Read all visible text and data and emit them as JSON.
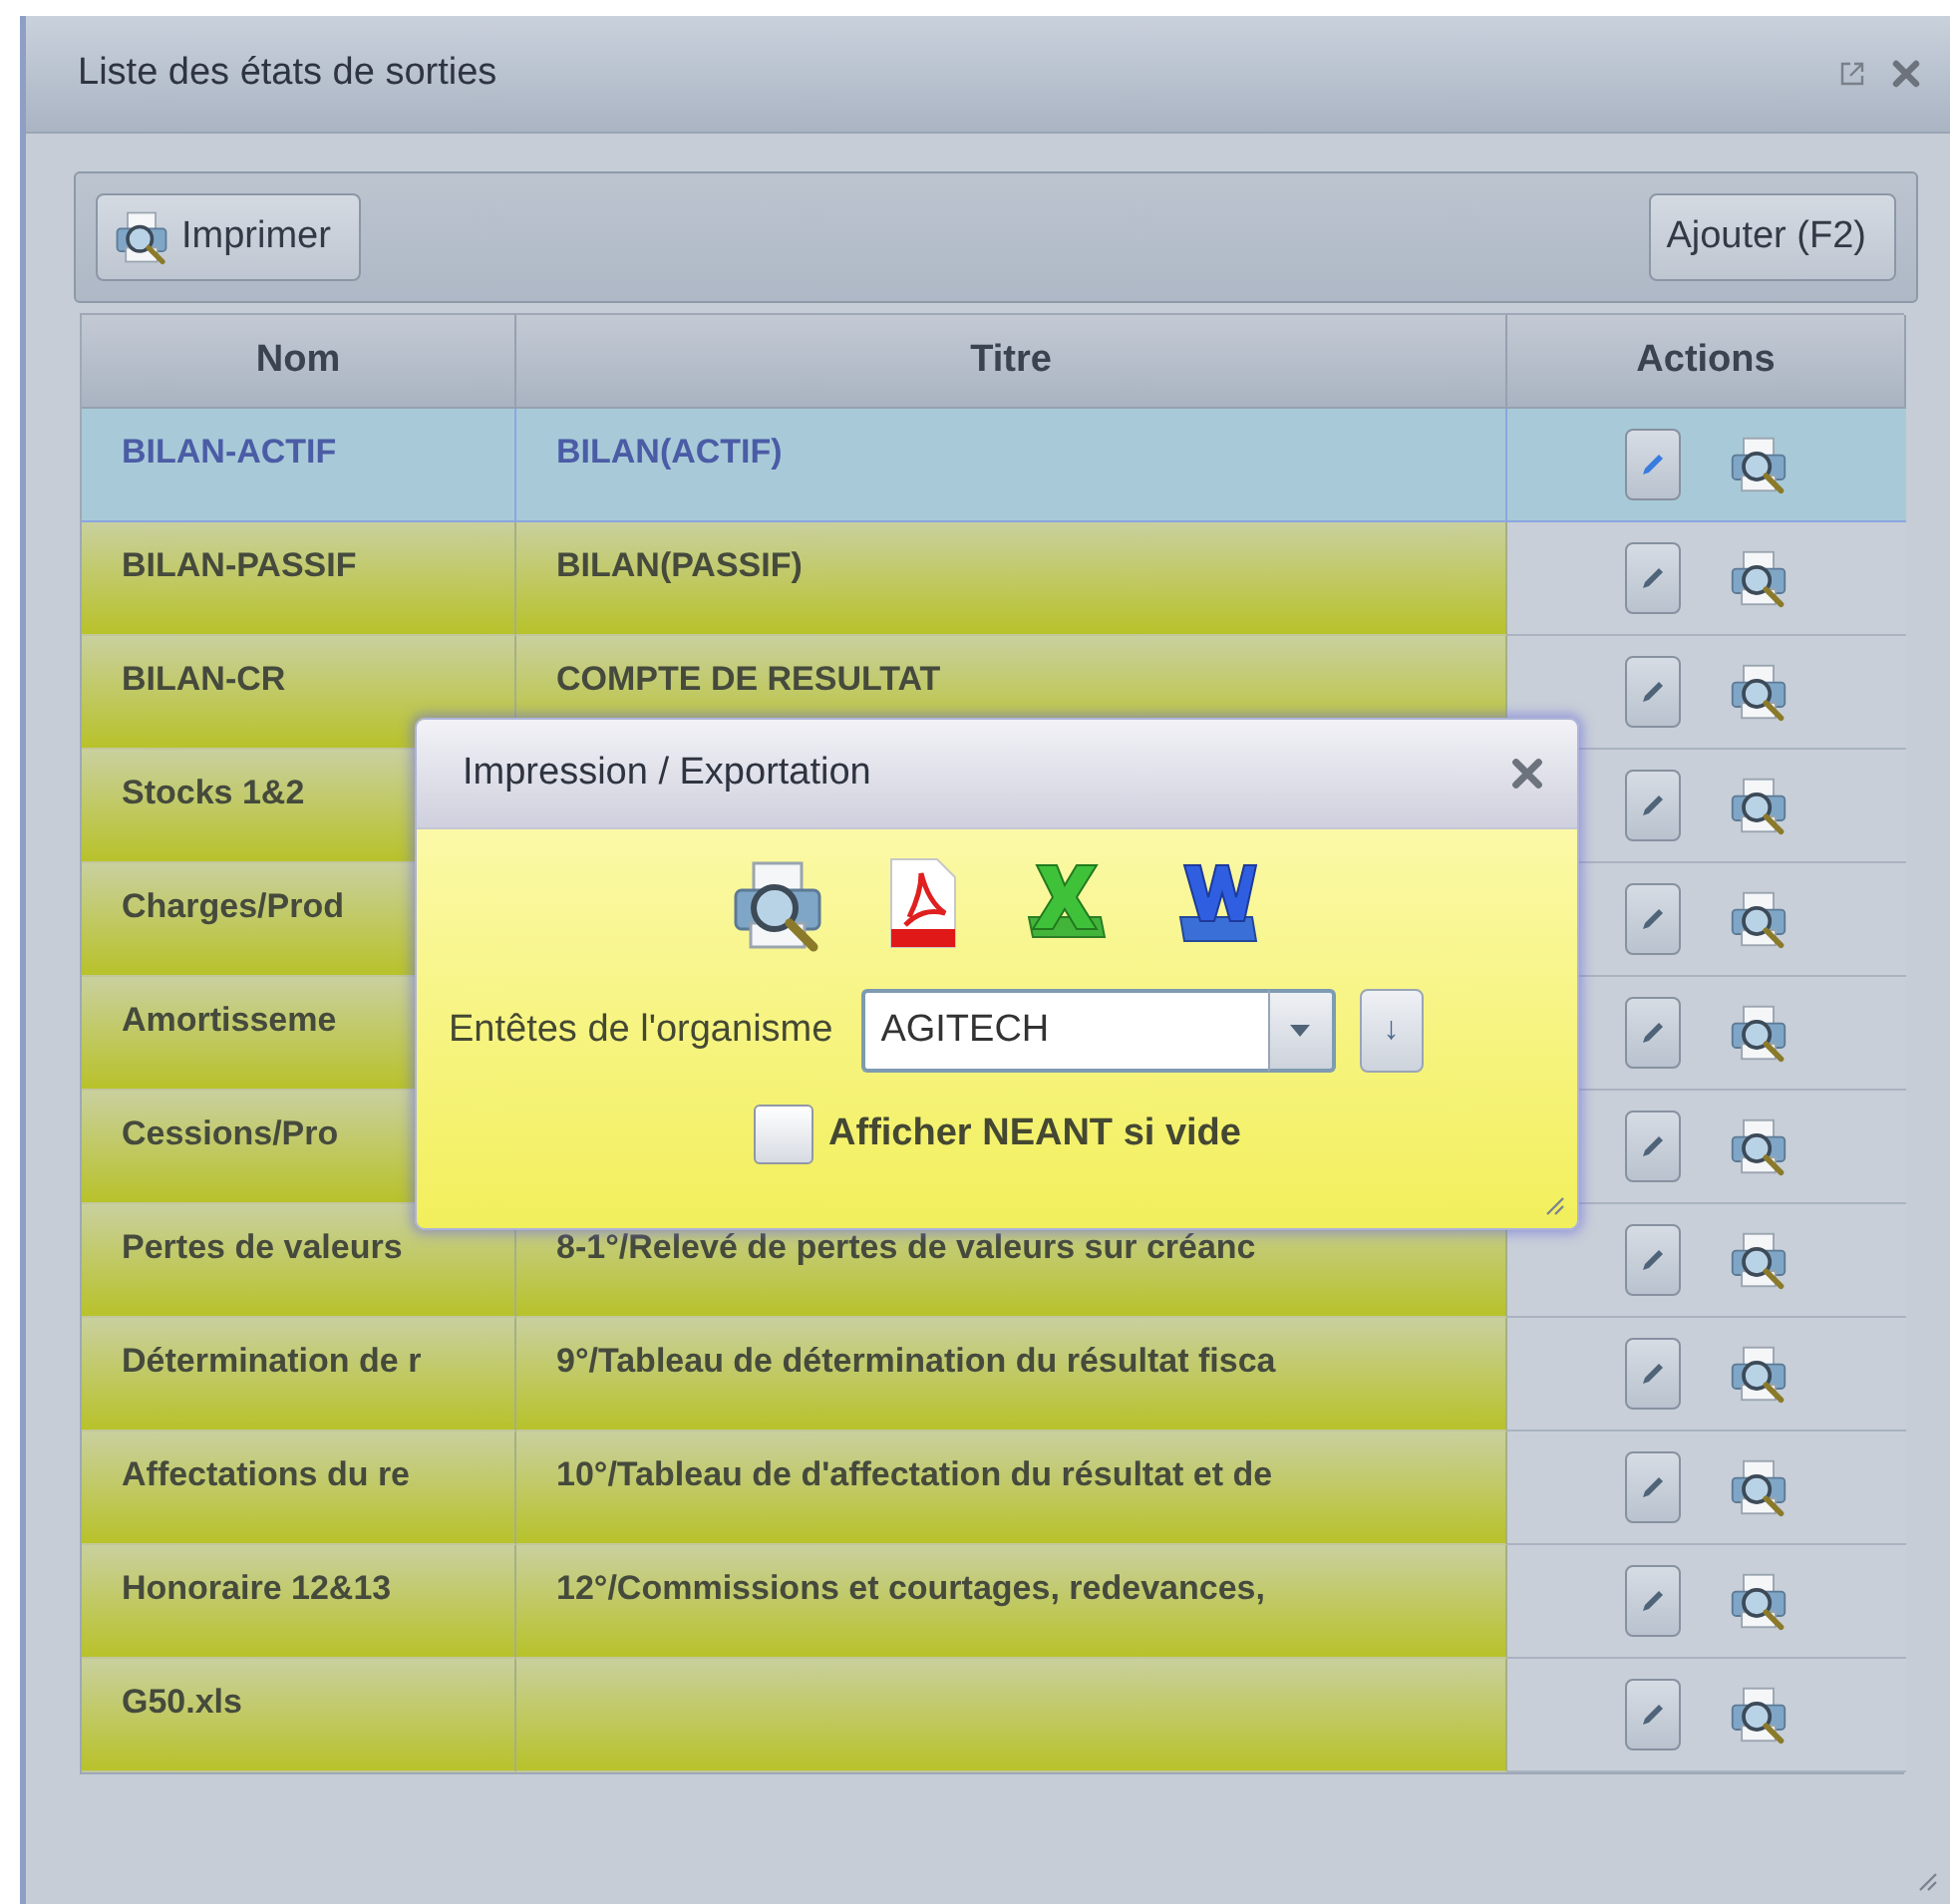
{
  "window": {
    "title": "Liste des états de sorties"
  },
  "toolbar": {
    "buttons": [
      {
        "label": "Imprimer",
        "kind": "print"
      },
      {
        "label": "Ajouter (F2)",
        "kind": "plain"
      }
    ]
  },
  "table": {
    "columns": [
      "Nom",
      "Titre",
      "Actions"
    ],
    "rows": [
      {
        "nom": "BILAN-ACTIF",
        "titre": "BILAN(ACTIF)",
        "selected": true
      },
      {
        "nom": "BILAN-PASSIF",
        "titre": "BILAN(PASSIF)",
        "selected": false
      },
      {
        "nom": "BILAN-CR",
        "titre": "COMPTE DE RESULTAT",
        "selected": false
      },
      {
        "nom": "Stocks 1&2",
        "selected": false
      },
      {
        "nom": "Charges/Prod",
        "selected": false
      },
      {
        "nom": "Amortisseme",
        "selected": false
      },
      {
        "nom": "Cessions/Pro",
        "selected": false
      },
      {
        "nom": "Pertes de valeurs",
        "titre": "8-1°/Relevé de pertes de valeurs sur créanc",
        "selected": false
      },
      {
        "nom": "Détermination de r",
        "titre": "9°/Tableau de détermination du résultat fisca",
        "selected": false
      },
      {
        "nom": "Affectations du re",
        "titre": "10°/Tableau de d'affectation du résultat et de",
        "selected": false
      },
      {
        "nom": "Honoraire 12&13",
        "titre": "12°/Commissions et courtages, redevances,",
        "selected": false
      },
      {
        "nom": "G50.xls",
        "selected": false
      }
    ]
  },
  "dialog": {
    "title": "Impression / Exportation",
    "field": {
      "label": "Entêtes de l'organisme",
      "value": "AGITECH"
    },
    "arrow_button": "↓",
    "checkbox": {
      "label": "Afficher NEANT si vide",
      "checked": false
    }
  }
}
